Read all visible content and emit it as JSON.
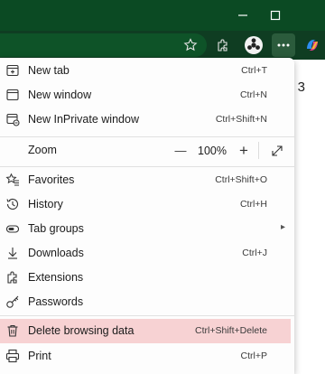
{
  "colors": {
    "titlebar": "#0b4a23",
    "toolbar": "#0f3d22",
    "menu_bg": "#fdfdfd",
    "highlight": "#f7d2d3"
  },
  "window": {
    "controls": [
      "minimize-icon",
      "maximize-icon"
    ]
  },
  "toolbar": {
    "icons": [
      "favorite-star-icon",
      "extensions-icon",
      "profile-avatar-icon",
      "more-menu-icon",
      "copilot-icon"
    ]
  },
  "page": {
    "partial_text": "3"
  },
  "menu": {
    "items": [
      {
        "label": "New tab",
        "shortcut": "Ctrl+T",
        "icon": "new-tab-icon"
      },
      {
        "label": "New window",
        "shortcut": "Ctrl+N",
        "icon": "new-window-icon"
      },
      {
        "label": "New InPrivate window",
        "shortcut": "Ctrl+Shift+N",
        "icon": "inprivate-icon"
      }
    ],
    "zoom": {
      "label": "Zoom",
      "value": "100%",
      "minus": "—",
      "plus": "+",
      "fullscreen_icon": "fullscreen-icon"
    },
    "items2": [
      {
        "label": "Favorites",
        "shortcut": "Ctrl+Shift+O",
        "icon": "favorites-icon"
      },
      {
        "label": "History",
        "shortcut": "Ctrl+H",
        "icon": "history-icon"
      },
      {
        "label": "Tab groups",
        "shortcut": "",
        "icon": "tab-groups-icon",
        "submenu": "▸"
      },
      {
        "label": "Downloads",
        "shortcut": "Ctrl+J",
        "icon": "download-icon"
      },
      {
        "label": "Extensions",
        "shortcut": "",
        "icon": "extensions-icon"
      },
      {
        "label": "Passwords",
        "shortcut": "",
        "icon": "key-icon"
      }
    ],
    "items3": [
      {
        "label": "Delete browsing data",
        "shortcut": "Ctrl+Shift+Delete",
        "icon": "trash-icon",
        "highlighted": true
      },
      {
        "label": "Print",
        "shortcut": "Ctrl+P",
        "icon": "print-icon"
      }
    ]
  }
}
